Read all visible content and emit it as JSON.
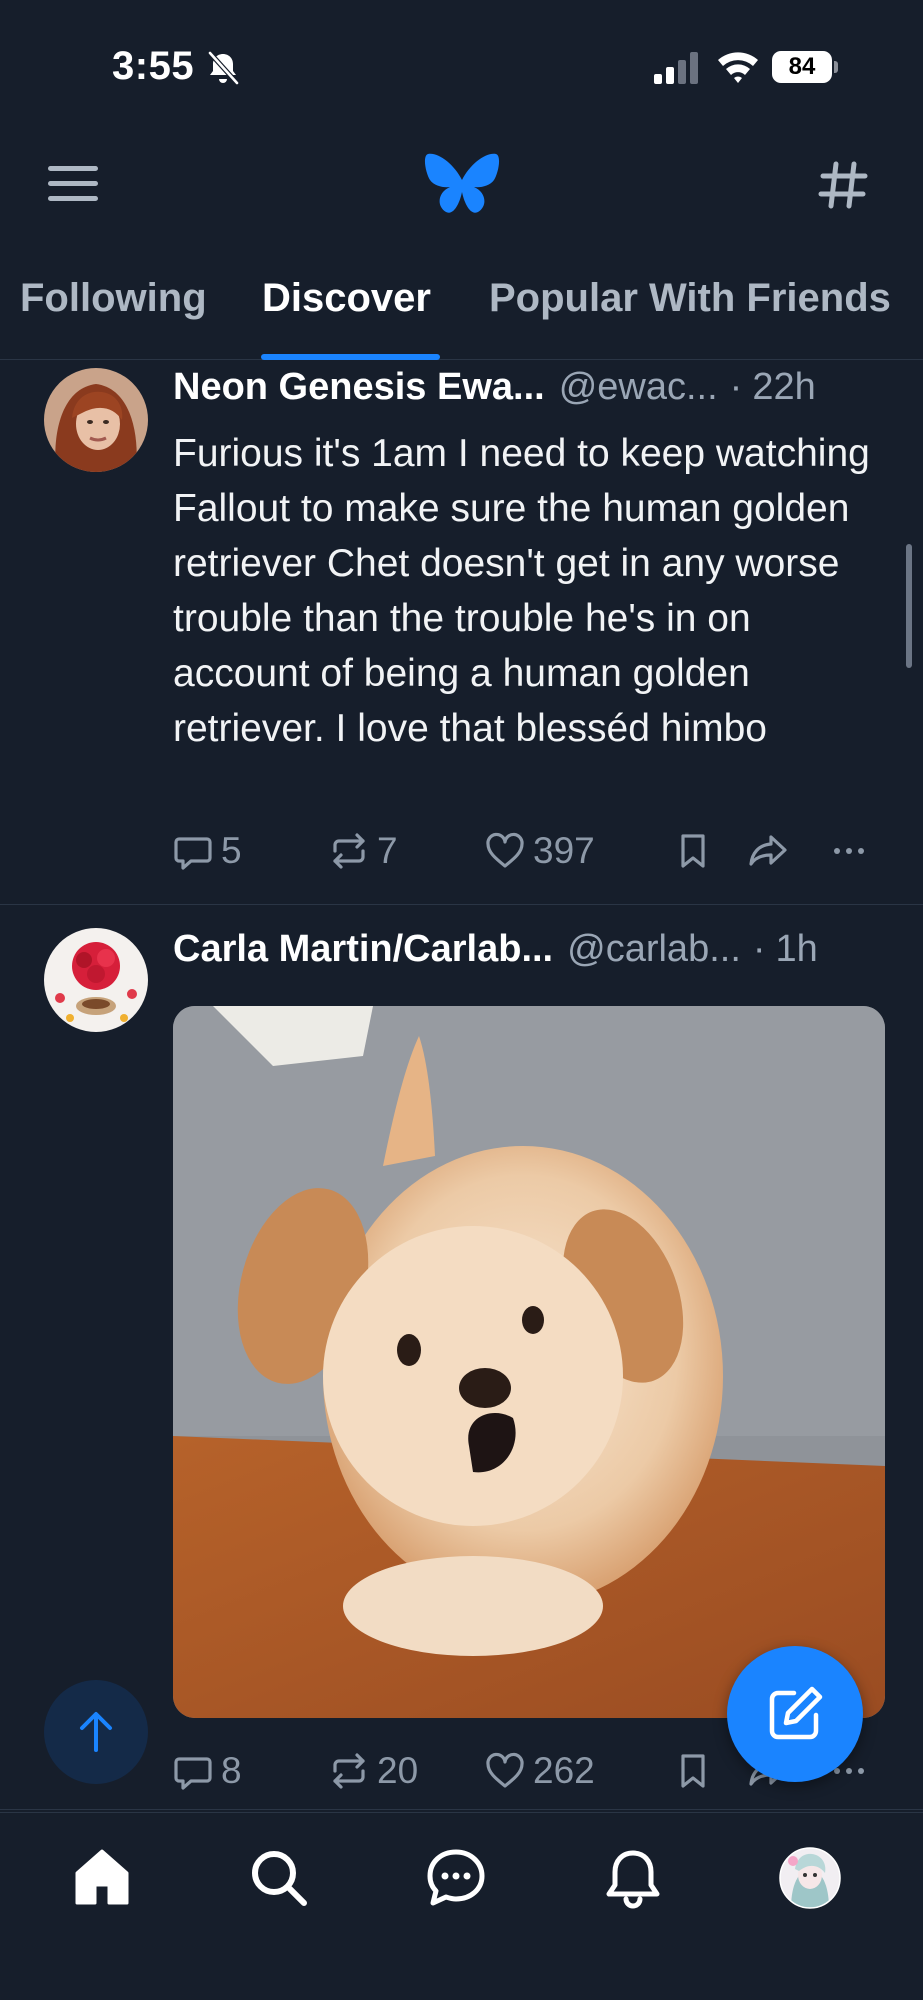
{
  "status_bar": {
    "time": "3:55",
    "battery": "84"
  },
  "header": {
    "menu_icon": "hamburger-menu-icon",
    "logo_icon": "butterfly-logo-icon",
    "feeds_icon": "hash-icon"
  },
  "tabs": [
    {
      "label": "Following",
      "active": false
    },
    {
      "label": "Discover",
      "active": true
    },
    {
      "label": "Popular With Friends",
      "active": false
    }
  ],
  "posts": [
    {
      "display_name": "Neon Genesis Ewa...",
      "handle": "@ewac...",
      "separator": "·",
      "time": "22h",
      "text": "Furious it's 1am I need to keep watching Fallout to make sure the human golden retriever Chet doesn't get in any worse trouble than the trouble he's in on account of being a human golden retriever. I love that blesséd himbo",
      "replies": "5",
      "reposts": "7",
      "likes": "397"
    },
    {
      "display_name": "Carla Martin/Carlab...",
      "handle": "@carlab...",
      "separator": "·",
      "time": "1h",
      "media": "puppy-gif",
      "replies": "8",
      "reposts": "20",
      "likes": "262"
    }
  ],
  "nav": [
    "home-icon",
    "search-icon",
    "chat-icon",
    "bell-icon",
    "profile-avatar"
  ],
  "colors": {
    "background": "#161e2b",
    "accent": "#1a84ff",
    "muted_text": "#9aa6b5",
    "divider": "#2a3545"
  }
}
